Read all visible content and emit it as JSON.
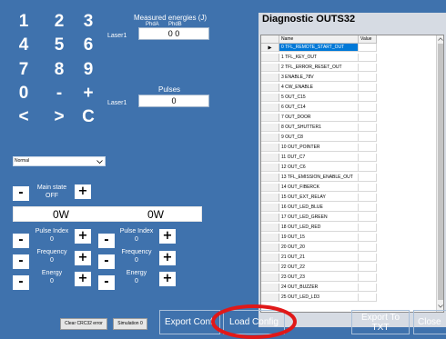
{
  "keypad": [
    {
      "key": "1"
    },
    {
      "key": "2"
    },
    {
      "key": "3"
    },
    {
      "key": "4"
    },
    {
      "key": "5"
    },
    {
      "key": "6"
    },
    {
      "key": "7"
    },
    {
      "key": "8"
    },
    {
      "key": "9"
    },
    {
      "key": "0"
    },
    {
      "key": "-"
    },
    {
      "key": "+"
    },
    {
      "key": "<"
    },
    {
      "key": ">"
    },
    {
      "key": "C"
    }
  ],
  "measured": {
    "title": "Measured energies (J)",
    "col_a": "PhdA",
    "col_b": "PhdB",
    "laser_label": "Laser1",
    "value": "0 0"
  },
  "pulses": {
    "title": "Pulses",
    "laser_label": "Laser1",
    "value": "0"
  },
  "mode_select": {
    "value": "Normal"
  },
  "main_state": {
    "label": "Main state",
    "value": "OFF"
  },
  "power": {
    "left": "0W",
    "right": "0W"
  },
  "spinners": {
    "left": [
      {
        "label": "Pulse Index",
        "value": "0"
      },
      {
        "label": "Frequency",
        "value": "0"
      },
      {
        "label": "Energy",
        "value": "0"
      }
    ],
    "right": [
      {
        "label": "Pulse Index",
        "value": "0"
      },
      {
        "label": "Frequency",
        "value": "0"
      },
      {
        "label": "Energy",
        "value": "0"
      }
    ],
    "minus": "-",
    "plus": "+"
  },
  "diagnostic": {
    "title": "Diagnostic OUTS32",
    "col_name": "Name",
    "col_value": "Value",
    "rows": [
      "0 TFL_REMOTE_START_OUT",
      "1 TFL_KEY_OUT",
      "2 TFL_ERROR_RESET_OUT",
      "3 ENABLE_78V",
      "4 CW_ENABLE",
      "5 OUT_C15",
      "6 OUT_C14",
      "7 OUT_DOOR",
      "8 OUT_SHUTTER1",
      "9 OUT_C8",
      "10 OUT_POINTER",
      "11 OUT_C7",
      "12 OUT_C6",
      "13 TFL_EMISSION_ENABLE_OUT",
      "14 OUT_FIBERCK",
      "15 OUT_EXT_RELAY",
      "16 OUT_LED_BLUE",
      "17 OUT_LED_GREEN",
      "18 OUT_LED_RED",
      "19 OUT_15",
      "20 OUT_20",
      "21 OUT_21",
      "22 OUT_22",
      "23 OUT_23",
      "24 OUT_BUZZER",
      "25 OUT_LED_LD3"
    ]
  },
  "bottom": {
    "clear_crc": "Clear CRC32 error",
    "simulation": "Simulation 0",
    "export_config": "Export Confi",
    "load_config": "Load Config",
    "export_txt_1": "Export To",
    "export_txt_2": "TXT",
    "close": "Close"
  },
  "colors": {
    "background": "#3f72ad",
    "frame": "#f08a2a",
    "selection": "#0078d7",
    "highlight_circle": "#e01818"
  }
}
